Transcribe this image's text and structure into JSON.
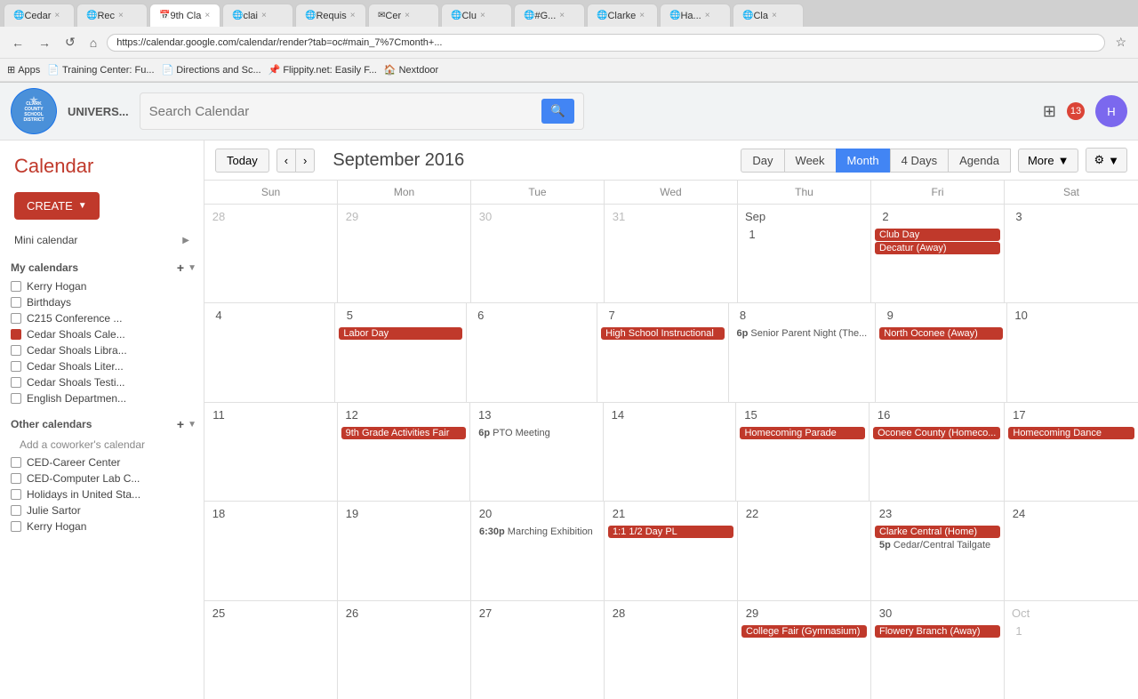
{
  "browser": {
    "tabs": [
      {
        "label": "Cedar",
        "active": false
      },
      {
        "label": "Rec",
        "active": false
      },
      {
        "label": "9th Cla",
        "active": true
      },
      {
        "label": "clai",
        "active": false
      },
      {
        "label": "Requis",
        "active": false
      },
      {
        "label": "Cer",
        "active": false
      },
      {
        "label": "Clu",
        "active": false
      },
      {
        "label": "#G...",
        "active": false
      },
      {
        "label": "Clarke",
        "active": false
      },
      {
        "label": "Ha...",
        "active": false
      },
      {
        "label": "Cla",
        "active": false
      }
    ],
    "address": "https://calendar.google.com/calendar/render?tab=oc#main_7%7Cmonth+...",
    "bookmarks": [
      "Apps",
      "Training Center: Fu...",
      "Directions and Sc...",
      "Flippity.net: Easily F...",
      "Nextdoor"
    ]
  },
  "header": {
    "logo_text": "CLARK\nCOUNTY\nSCHOOL\nDISTRICT",
    "search_placeholder": "Search Calendar",
    "search_btn_icon": "🔍",
    "notification_count": "13",
    "avatar_initials": "H"
  },
  "sidebar": {
    "title": "Calendar",
    "create_label": "CREATE",
    "mini_calendar_label": "Mini calendar",
    "my_calendars_label": "My calendars",
    "my_calendars": [
      {
        "label": "Kerry Hogan",
        "checked": false,
        "color": "#fff"
      },
      {
        "label": "Birthdays",
        "checked": false,
        "color": "#fff"
      },
      {
        "label": "C215 Conference ...",
        "checked": false,
        "color": "#fff"
      },
      {
        "label": "Cedar Shoals Cale...",
        "checked": true,
        "color": "#c0392b"
      },
      {
        "label": "Cedar Shoals Libra...",
        "checked": false,
        "color": "#fff"
      },
      {
        "label": "Cedar Shoals Liter...",
        "checked": false,
        "color": "#fff"
      },
      {
        "label": "Cedar Shoals Testi...",
        "checked": false,
        "color": "#fff"
      },
      {
        "label": "English Departmen...",
        "checked": false,
        "color": "#fff"
      }
    ],
    "other_calendars_label": "Other calendars",
    "add_calendar_label": "Add a coworker's calendar",
    "other_calendars": [
      {
        "label": "CED-Career Center",
        "checked": false
      },
      {
        "label": "CED-Computer Lab C...",
        "checked": false
      },
      {
        "label": "Holidays in United Sta...",
        "checked": false
      },
      {
        "label": "Julie Sartor",
        "checked": false
      },
      {
        "label": "Kerry Hogan",
        "checked": false
      }
    ]
  },
  "toolbar": {
    "today_label": "Today",
    "prev_icon": "‹",
    "next_icon": "›",
    "title": "September 2016",
    "views": [
      "Day",
      "Week",
      "Month",
      "4 Days",
      "Agenda"
    ],
    "active_view": "Month",
    "more_label": "More",
    "settings_icon": "⚙"
  },
  "calendar": {
    "day_headers": [
      "Sun",
      "Mon",
      "Tue",
      "Wed",
      "Thu",
      "Fri",
      "Sat"
    ],
    "weeks": [
      {
        "days": [
          {
            "num": "28",
            "other": true,
            "events": []
          },
          {
            "num": "29",
            "other": true,
            "events": []
          },
          {
            "num": "30",
            "other": true,
            "events": []
          },
          {
            "num": "31",
            "other": true,
            "events": []
          },
          {
            "num": "Sep 1",
            "label": "1",
            "events": []
          },
          {
            "num": "2",
            "events": [
              {
                "text": "Club Day",
                "style": "red"
              },
              {
                "text": "Decatur (Away)",
                "style": "red"
              }
            ]
          },
          {
            "num": "3",
            "events": []
          }
        ]
      },
      {
        "days": [
          {
            "num": "4",
            "events": []
          },
          {
            "num": "5",
            "events": [
              {
                "text": "Labor Day",
                "style": "red"
              }
            ]
          },
          {
            "num": "6",
            "events": []
          },
          {
            "num": "7",
            "events": [
              {
                "text": "High School Instructional",
                "style": "red"
              }
            ]
          },
          {
            "num": "8",
            "events": [
              {
                "text": "6p Senior Parent Night (The...",
                "style": "text-only"
              }
            ]
          },
          {
            "num": "9",
            "events": [
              {
                "text": "North Oconee (Away)",
                "style": "red"
              }
            ]
          },
          {
            "num": "10",
            "events": []
          }
        ]
      },
      {
        "days": [
          {
            "num": "11",
            "events": []
          },
          {
            "num": "12",
            "events": [
              {
                "text": "9th Grade Activities Fair",
                "style": "red"
              }
            ]
          },
          {
            "num": "13",
            "events": [
              {
                "text": "6p PTO Meeting",
                "style": "text-only"
              }
            ]
          },
          {
            "num": "14",
            "events": []
          },
          {
            "num": "15",
            "events": [
              {
                "text": "Homecoming Parade",
                "style": "red"
              }
            ]
          },
          {
            "num": "16",
            "events": [
              {
                "text": "Oconee County (Homeco...",
                "style": "red"
              }
            ]
          },
          {
            "num": "17",
            "events": [
              {
                "text": "Homecoming Dance",
                "style": "red"
              }
            ]
          }
        ]
      },
      {
        "days": [
          {
            "num": "18",
            "events": []
          },
          {
            "num": "19",
            "events": []
          },
          {
            "num": "20",
            "events": [
              {
                "text": "6:30p Marching Exhibition",
                "style": "text-only"
              }
            ]
          },
          {
            "num": "21",
            "events": [
              {
                "text": "1:1 1/2 Day PL",
                "style": "red"
              }
            ]
          },
          {
            "num": "22",
            "events": []
          },
          {
            "num": "23",
            "events": [
              {
                "text": "Clarke Central (Home)",
                "style": "red"
              },
              {
                "text": "5p Cedar/Central Tailgate",
                "style": "text-only"
              }
            ]
          },
          {
            "num": "24",
            "events": []
          }
        ]
      },
      {
        "days": [
          {
            "num": "25",
            "events": []
          },
          {
            "num": "26",
            "events": []
          },
          {
            "num": "27",
            "events": []
          },
          {
            "num": "28",
            "events": []
          },
          {
            "num": "29",
            "events": [
              {
                "text": "College Fair (Gymnasium)",
                "style": "red"
              }
            ]
          },
          {
            "num": "30",
            "events": [
              {
                "text": "Flowery Branch (Away)",
                "style": "red"
              }
            ]
          },
          {
            "num": "Oct 1",
            "other": true,
            "events": []
          }
        ]
      }
    ]
  }
}
